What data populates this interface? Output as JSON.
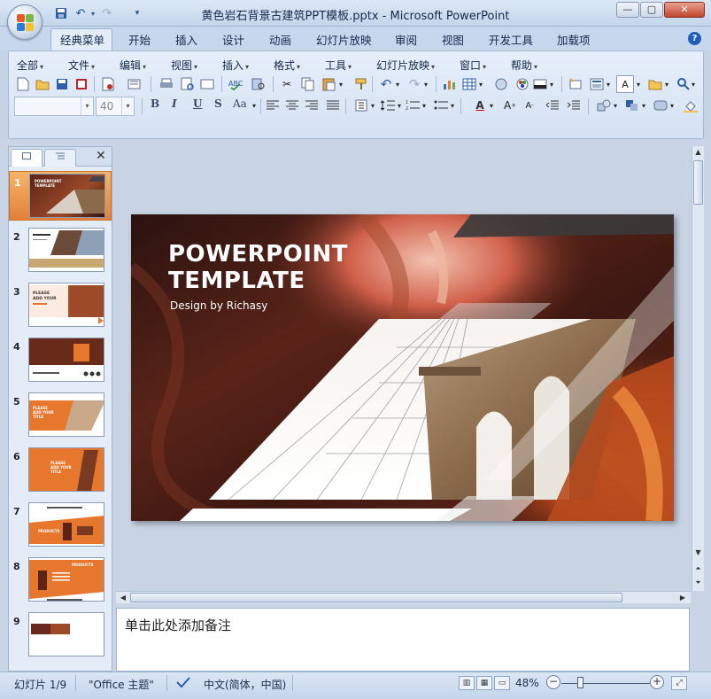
{
  "window": {
    "title": "黄色岩石背景古建筑PPT模板.pptx - Microsoft PowerPoint",
    "minimize_label": "—",
    "maximize_label": "▢",
    "close_label": "✕"
  },
  "ribbon_tabs": [
    {
      "label": "经典菜单",
      "active": true
    },
    {
      "label": "开始"
    },
    {
      "label": "插入"
    },
    {
      "label": "设计"
    },
    {
      "label": "动画"
    },
    {
      "label": "幻灯片放映"
    },
    {
      "label": "审阅"
    },
    {
      "label": "视图"
    },
    {
      "label": "开发工具"
    },
    {
      "label": "加载项"
    }
  ],
  "menus": [
    "全部",
    "文件",
    "编辑",
    "视图",
    "插入",
    "格式",
    "工具",
    "幻灯片放映",
    "窗口",
    "帮助"
  ],
  "format": {
    "font_name": "",
    "font_size": "40",
    "bold": "B",
    "italic": "I",
    "underline": "U",
    "shadow": "S",
    "change_case": "Aa"
  },
  "panel": {
    "tab_slides_icon": "slide-icon",
    "tab_outline_icon": "outline-icon",
    "close_label": "✕"
  },
  "thumbnails": [
    {
      "num": "1",
      "selected": true,
      "lines": [
        "POWERPOINT",
        "TEMPLATE"
      ]
    },
    {
      "num": "2"
    },
    {
      "num": "3",
      "lines": [
        "PLEASE",
        "ADD YOUR"
      ]
    },
    {
      "num": "4"
    },
    {
      "num": "5",
      "lines": [
        "PLEASE",
        "ADD YOUR",
        "TITLE"
      ]
    },
    {
      "num": "6",
      "lines": [
        "PLEASE",
        "ADD YOUR",
        "TITLE"
      ]
    },
    {
      "num": "7",
      "lines": [
        "PRODUCTS"
      ]
    },
    {
      "num": "8",
      "lines": [
        "PRODUCTS"
      ]
    },
    {
      "num": "9"
    }
  ],
  "slide": {
    "title": "POWERPOINT\nTEMPLATE",
    "subtitle": "Design by Richasy"
  },
  "notes": {
    "placeholder": "单击此处添加备注"
  },
  "status": {
    "slide_counter": "幻灯片 1/9",
    "theme": "\"Office 主题\"",
    "language": "中文(简体，中国)",
    "zoom": "48%"
  },
  "colors": {
    "accent_orange": "#e8772e",
    "ribbon_blue": "#d5e2f3",
    "canyon_dark": "#3a1a12"
  }
}
